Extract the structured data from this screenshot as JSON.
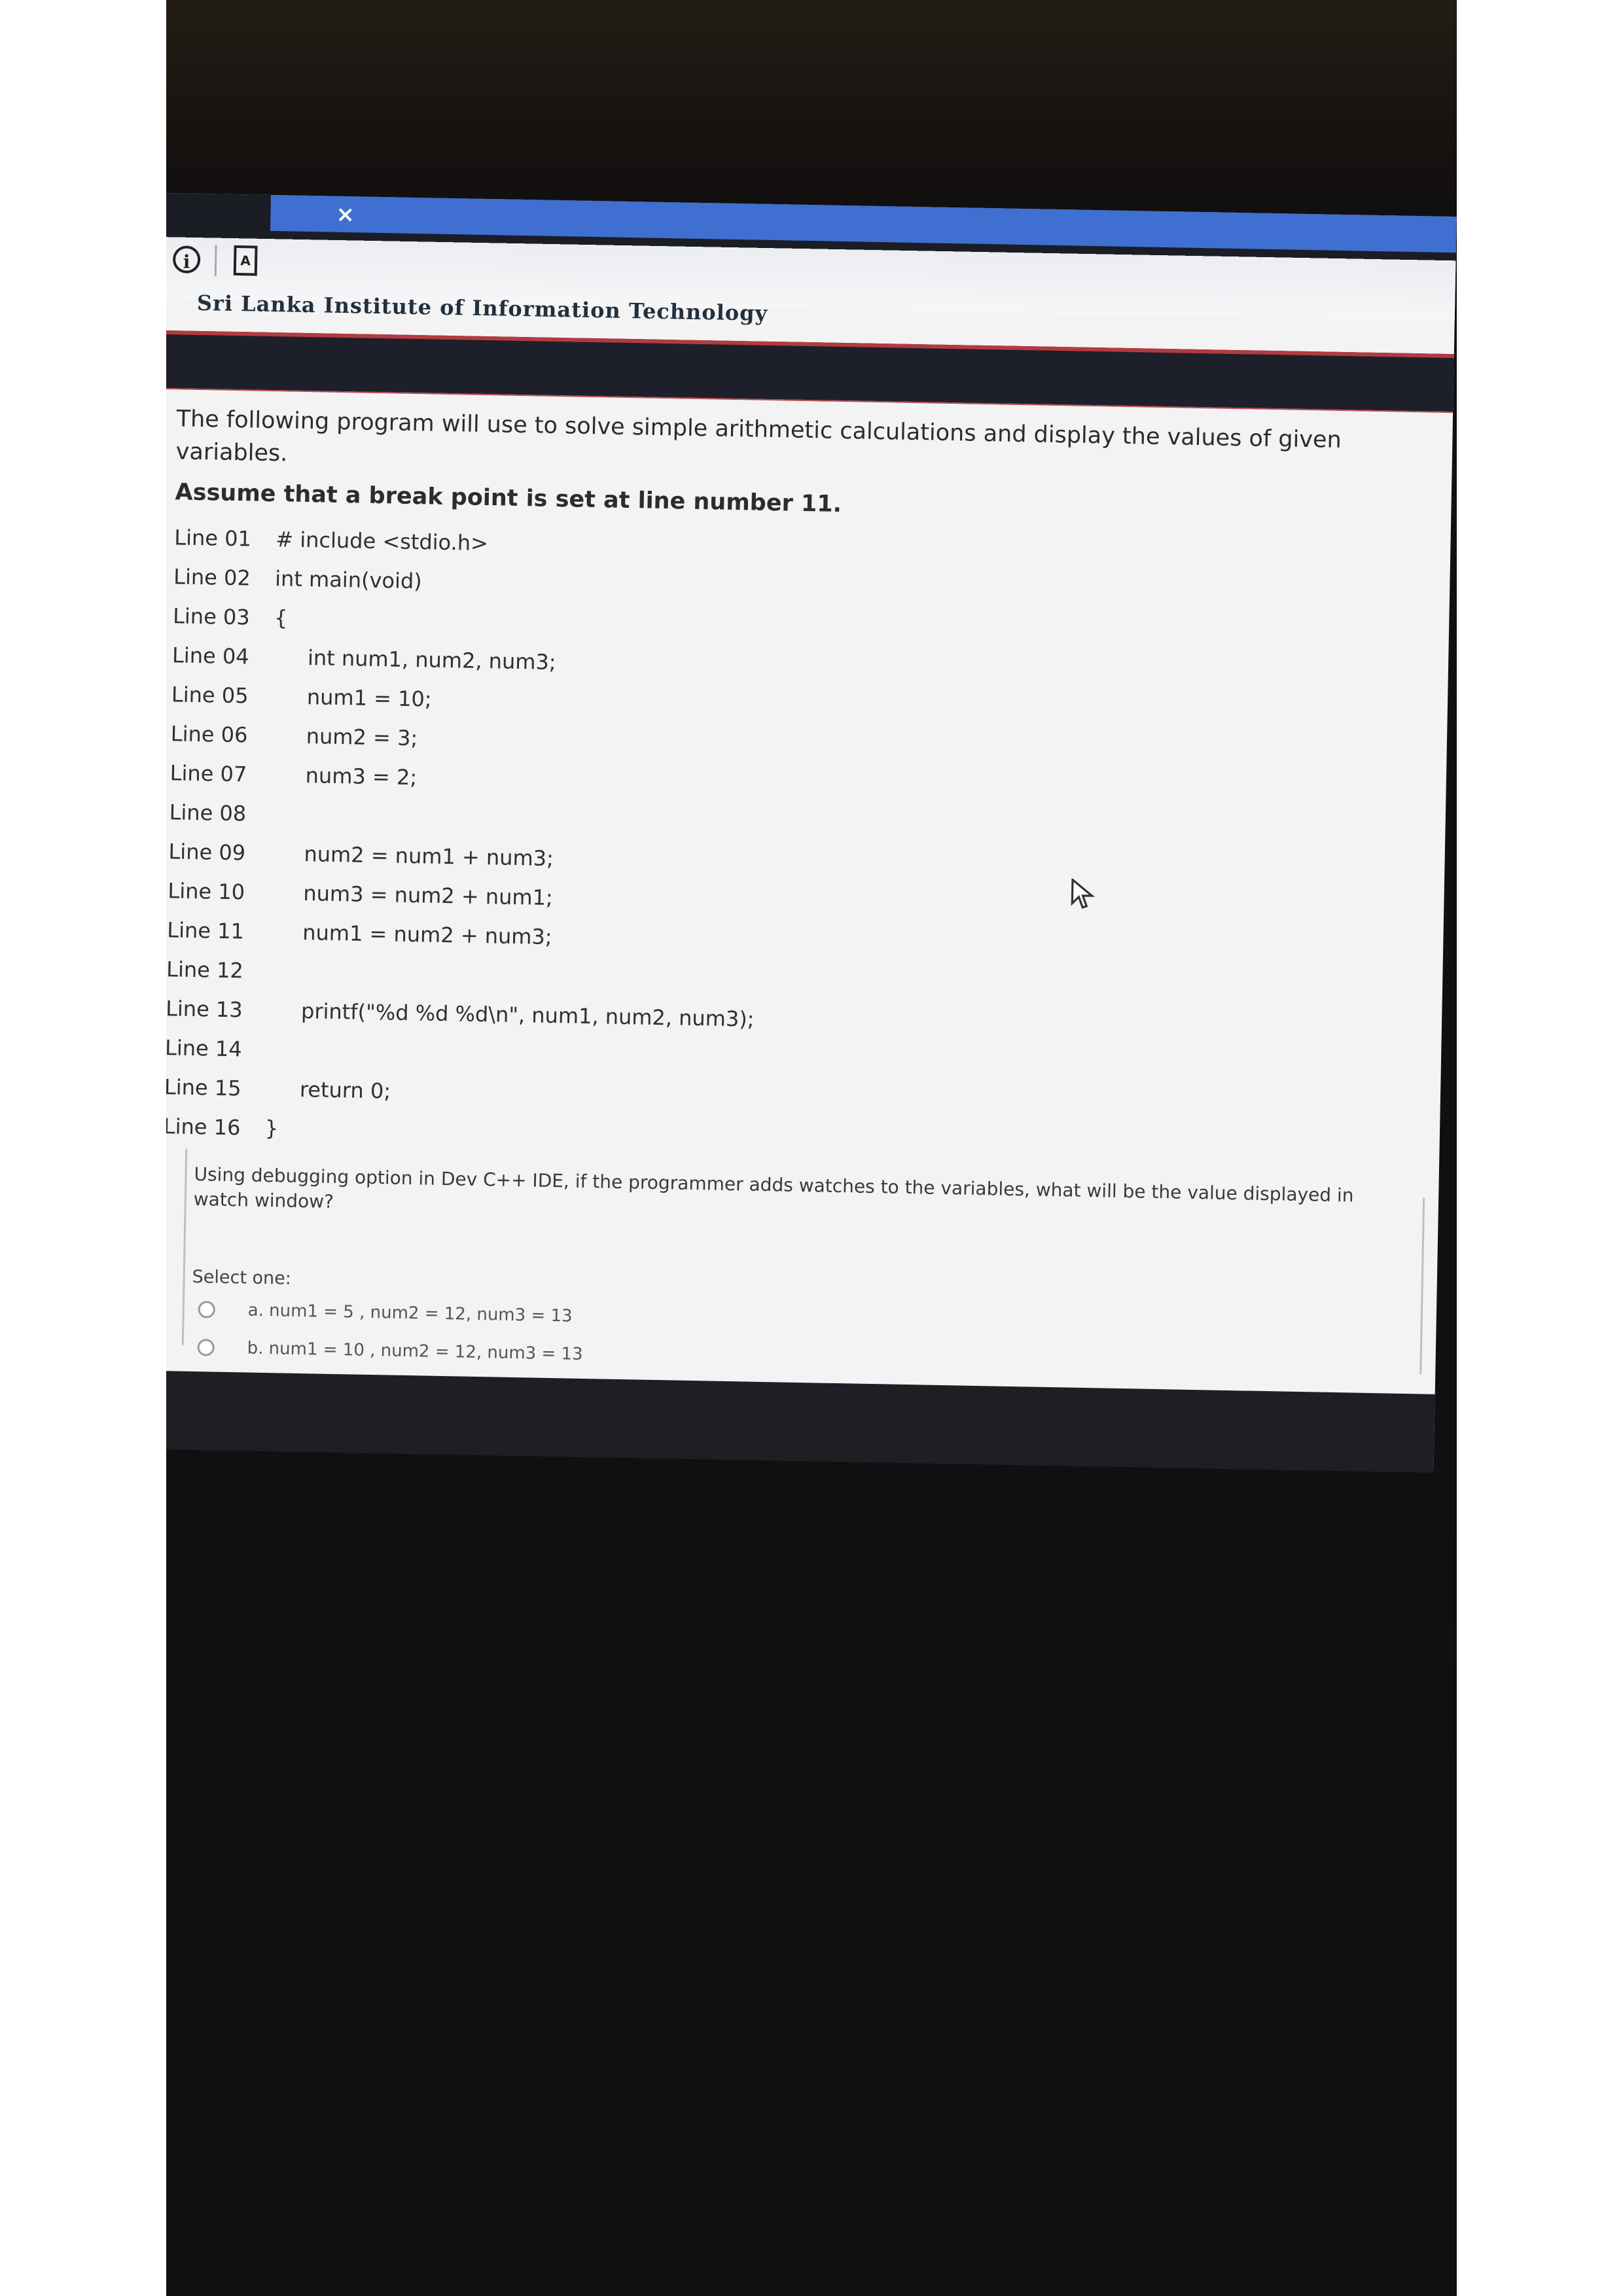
{
  "browser": {
    "tab_close_glyph": "×",
    "info_icon_glyph": "i",
    "page_icon_glyph": "A"
  },
  "site": {
    "title": "Sri Lanka Institute of Information Technology"
  },
  "question": {
    "intro_line1": "The following program will use to solve simple arithmetic calculations and display the  values of given variables.",
    "intro_line2": "Assume that a  break point is set at line number 11.",
    "code": [
      {
        "num": "Line 01",
        "text": "# include <stdio.h>"
      },
      {
        "num": "Line 02",
        "text": "int main(void)"
      },
      {
        "num": "Line 03",
        "text": "{"
      },
      {
        "num": "Line 04",
        "text": "int num1, num2, num3;"
      },
      {
        "num": "Line 05",
        "text": "num1 = 10;"
      },
      {
        "num": "Line 06",
        "text": "num2 = 3;"
      },
      {
        "num": "Line 07",
        "text": "num3 = 2;"
      },
      {
        "num": "Line 08",
        "text": ""
      },
      {
        "num": "Line 09",
        "text": "num2 = num1 + num3;"
      },
      {
        "num": "Line 10",
        "text": "num3 = num2 + num1;"
      },
      {
        "num": "Line 11",
        "text": "num1 = num2 + num3;"
      },
      {
        "num": "Line 12",
        "text": ""
      },
      {
        "num": "Line 13",
        "text": "printf(\"%d %d %d\\n\", num1, num2, num3);"
      },
      {
        "num": "Line 14",
        "text": ""
      },
      {
        "num": "Line 15",
        "text": "return 0;"
      },
      {
        "num": "Line 16",
        "text": "}"
      }
    ],
    "prompt": "Using debugging option in Dev C++ IDE, if the programmer adds watches to the variables, what will be the value displayed in watch window?",
    "select_one": "Select one:",
    "options": [
      {
        "label": "a. num1 = 5 , num2 = 12, num3 = 13"
      },
      {
        "label": "b. num1 = 10 , num2 = 12, num3 = 13"
      }
    ]
  },
  "colors": {
    "tab_strip": "#3f6fd0",
    "header_bar": "#1d1f2b",
    "header_accent": "#b53a40",
    "page_background": "#f3f3f3"
  },
  "icons": {
    "tab_close": "close-icon",
    "site_info": "info-icon",
    "page": "page-icon",
    "pointer": "mouse-cursor-icon"
  }
}
